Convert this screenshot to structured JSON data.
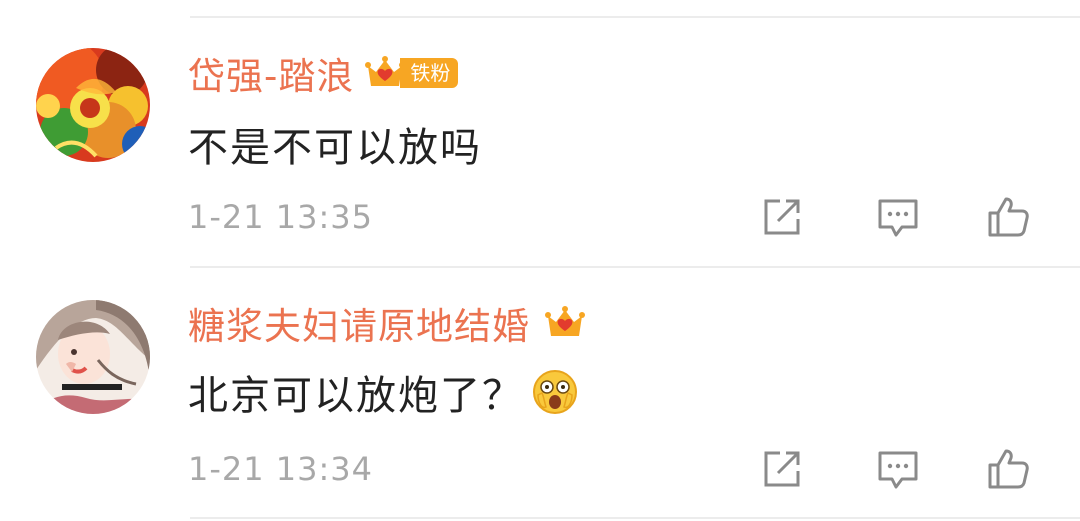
{
  "comments": [
    {
      "username": "岱强-踏浪",
      "badge": {
        "icon": "crown-badge-icon",
        "label": "铁粉"
      },
      "text": "不是不可以放吗",
      "emoji": null,
      "timestamp": "1-21 13:35",
      "avatar": "avatar-colorful-glass-art"
    },
    {
      "username": "糖浆夫妇请原地结婚",
      "badge": {
        "icon": "crown-badge-icon",
        "label": ""
      },
      "text": "北京可以放炮了？",
      "emoji": "shocked-face-emoji",
      "timestamp": "1-21 13:34",
      "avatar": "avatar-anime-girl"
    }
  ],
  "actions": {
    "repost_icon": "repost-icon",
    "reply_icon": "comment-icon",
    "like_icon": "thumbs-up-icon"
  },
  "colors": {
    "username": "#eb7350",
    "text": "#222222",
    "timestamp": "#a8a8a8",
    "icon": "#8a8a8a",
    "badge": "#f7a623",
    "divider": "#ececec"
  }
}
